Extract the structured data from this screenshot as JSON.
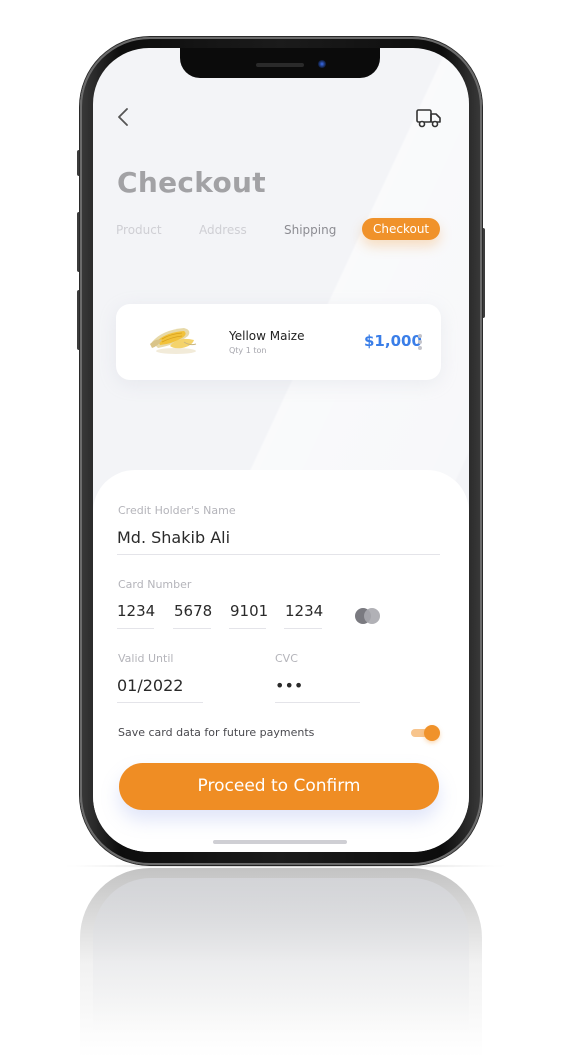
{
  "header": {
    "title": "Checkout",
    "back_icon": "chevron-left-icon",
    "truck_icon": "truck-icon"
  },
  "steps": [
    {
      "label": "Product",
      "state": "inactive"
    },
    {
      "label": "Address",
      "state": "inactive"
    },
    {
      "label": "Shipping",
      "state": "inactive"
    },
    {
      "label": "Checkout",
      "state": "active"
    }
  ],
  "product": {
    "name": "Yellow Maize",
    "quantity": "Qty 1 ton",
    "price": "$1,000",
    "more_icon": "more-vertical-icon"
  },
  "payment": {
    "holder_label": "Credit Holder's Name",
    "holder_value": "Md. Shakib Ali",
    "card_label": "Card Number",
    "card_groups": [
      "1234",
      "5678",
      "9101",
      "1234"
    ],
    "card_brand_icon": "card-brand-icon",
    "valid_label": "Valid Until",
    "valid_value": "01/2022",
    "cvc_label": "CVC",
    "cvc_value": "•••",
    "save_label": "Save card data for future payments",
    "save_enabled": true
  },
  "actions": {
    "proceed_label": "Proceed to Confirm"
  },
  "colors": {
    "accent": "#f0922a",
    "price": "#3a7ee8",
    "title": "#a2a2a5",
    "background": "#f3f4f7"
  }
}
